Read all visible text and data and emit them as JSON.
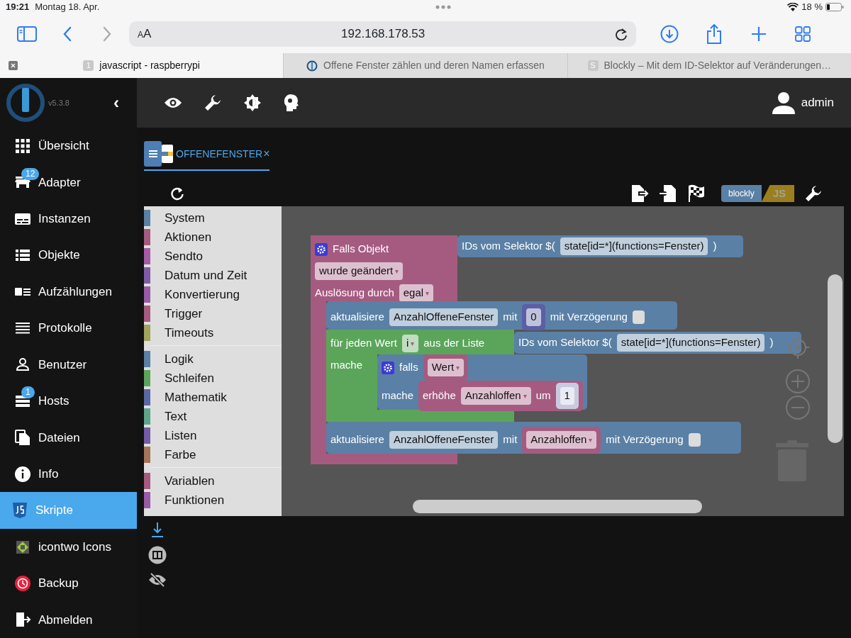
{
  "status_bar": {
    "time": "19:21",
    "date": "Montag 18. Apr.",
    "battery_text": "18 %"
  },
  "browser": {
    "text_size_button": "AA",
    "url": "192.168.178.53",
    "tabs": [
      {
        "title": "javascript - raspberrypi",
        "favicon": "1",
        "selected": true
      },
      {
        "title": "Offene Fenster zählen und deren Namen erfassen",
        "selected": false
      },
      {
        "title": "Blockly – Mit dem ID-Selektor auf Veränderungen…",
        "favicon": "S",
        "selected": false
      }
    ]
  },
  "sidebar": {
    "version": "v5.3.8",
    "collapse": "‹",
    "items": [
      {
        "label": "Übersicht",
        "selected": false
      },
      {
        "label": "Adapter",
        "badge": "12",
        "selected": false
      },
      {
        "label": "Instanzen",
        "selected": false
      },
      {
        "label": "Objekte",
        "selected": false
      },
      {
        "label": "Aufzählungen",
        "selected": false
      },
      {
        "label": "Protokolle",
        "selected": false
      },
      {
        "label": "Benutzer",
        "selected": false
      },
      {
        "label": "Hosts",
        "badge": "1",
        "selected": false
      },
      {
        "label": "Dateien",
        "selected": false
      },
      {
        "label": "Info",
        "selected": false
      },
      {
        "label": "Skripte",
        "selected": true
      },
      {
        "label": "icontwo Icons",
        "selected": false
      },
      {
        "label": "Backup",
        "selected": false
      },
      {
        "label": "Abmelden",
        "selected": false
      }
    ]
  },
  "header": {
    "user": "admin"
  },
  "script_tabs": [
    {
      "title": "OFFENEFENSTER",
      "close": "×",
      "selected": true
    }
  ],
  "toolbar": {
    "mode_toggle": [
      {
        "label": "blockly",
        "selected": true
      },
      {
        "label": "JS",
        "selected": false
      }
    ]
  },
  "toolbox": {
    "groups": [
      [
        {
          "label": "System",
          "color": "#5b80a5"
        },
        {
          "label": "Aktionen",
          "color": "#a55b80"
        },
        {
          "label": "Sendto",
          "color": "#a55ba5"
        },
        {
          "label": "Datum und Zeit",
          "color": "#805ba5"
        },
        {
          "label": "Konvertierung",
          "color": "#995ba5"
        },
        {
          "label": "Trigger",
          "color": "#a55b80"
        },
        {
          "label": "Timeouts",
          "color": "#9fa55b"
        }
      ],
      [
        {
          "label": "Logik",
          "color": "#5b80a5"
        },
        {
          "label": "Schleifen",
          "color": "#5ba55b"
        },
        {
          "label": "Mathematik",
          "color": "#5b67a5"
        },
        {
          "label": "Text",
          "color": "#5ba58c"
        },
        {
          "label": "Listen",
          "color": "#745ba5"
        },
        {
          "label": "Farbe",
          "color": "#a5745b"
        }
      ],
      [
        {
          "label": "Variablen",
          "color": "#a55b80"
        },
        {
          "label": "Funktionen",
          "color": "#995ba5"
        }
      ]
    ]
  },
  "workspace": {
    "blocks": [
      {
        "kind": "event",
        "lines": [
          {
            "parts": [
              {
                "kind": "gear"
              },
              {
                "kind": "text",
                "text": "Falls Objekt"
              }
            ]
          },
          {
            "parts": [
              {
                "kind": "dropdown",
                "text": "wurde geändert",
                "arrow": "▾"
              }
            ]
          },
          {
            "parts": [
              {
                "kind": "text",
                "text": "Auslösung durch"
              },
              {
                "kind": "dropdown",
                "text": "egal",
                "arrow": "▾"
              }
            ]
          }
        ],
        "attached": {
          "kind": "logic",
          "lines": [
            {
              "parts": [
                {
                  "kind": "text",
                  "text": "IDs vom Selektor $("
                },
                {
                  "kind": "field",
                  "text": "state[id=*](functions=Fenster)"
                },
                {
                  "kind": "text",
                  "text": ")"
                }
              ]
            }
          ]
        },
        "statements": [
          {
            "kind": "logic",
            "lines": [
              {
                "parts": [
                  {
                    "kind": "text",
                    "text": "aktualisiere"
                  },
                  {
                    "kind": "field",
                    "text": "AnzahlOffeneFenster"
                  },
                  {
                    "kind": "text",
                    "text": "mit"
                  },
                  {
                    "kind": "block",
                    "block": {
                      "kind": "math",
                      "lines": [
                        {
                          "parts": [
                            {
                              "kind": "field",
                              "text": "0"
                            }
                          ]
                        }
                      ]
                    }
                  },
                  {
                    "kind": "text",
                    "text": "mit Verzögerung"
                  },
                  {
                    "kind": "checkbox",
                    "checked": false
                  }
                ]
              }
            ]
          },
          {
            "kind": "loop",
            "lines": [
              {
                "parts": [
                  {
                    "kind": "text",
                    "text": "für jeden Wert"
                  },
                  {
                    "kind": "dropdown",
                    "text": "i",
                    "arrow": "▾"
                  },
                  {
                    "kind": "text",
                    "text": "aus der Liste"
                  }
                ]
              },
              {
                "parts": [
                  {
                    "kind": "text",
                    "text": "mache"
                  }
                ]
              }
            ],
            "attached": {
              "kind": "logic",
              "lines": [
                {
                  "parts": [
                    {
                      "kind": "text",
                      "text": "IDs vom Selektor $("
                    },
                    {
                      "kind": "field",
                      "text": "state[id=*](functions=Fenster)"
                    },
                    {
                      "kind": "text",
                      "text": ")"
                    }
                  ]
                }
              ]
            },
            "statements": [
              {
                "kind": "logic",
                "lines": [
                  {
                    "parts": [
                      {
                        "kind": "gear"
                      },
                      {
                        "kind": "text",
                        "text": "falls"
                      },
                      {
                        "kind": "block",
                        "block": {
                          "kind": "event",
                          "lines": [
                            {
                              "parts": [
                                {
                                  "kind": "dropdown",
                                  "text": "Wert",
                                  "arrow": "▾"
                                }
                              ]
                            }
                          ]
                        }
                      }
                    ]
                  },
                  {
                    "parts": [
                      {
                        "kind": "text",
                        "text": "mache"
                      },
                      {
                        "kind": "block",
                        "block": {
                          "kind": "event",
                          "lines": [
                            {
                              "parts": [
                                {
                                  "kind": "text",
                                  "text": "erhöhe"
                                },
                                {
                                  "kind": "dropdown",
                                  "text": "Anzahloffen",
                                  "arrow": "▾"
                                },
                                {
                                  "kind": "text",
                                  "text": "um"
                                },
                                {
                                  "kind": "block",
                                  "block": {
                                    "kind": "shadow",
                                    "lines": [
                                      {
                                        "parts": [
                                          {
                                            "kind": "field",
                                            "text": "1"
                                          }
                                        ]
                                      }
                                    ]
                                  }
                                }
                              ]
                            }
                          ]
                        }
                      }
                    ]
                  }
                ]
              }
            ]
          },
          {
            "kind": "logic",
            "lines": [
              {
                "parts": [
                  {
                    "kind": "text",
                    "text": "aktualisiere"
                  },
                  {
                    "kind": "field",
                    "text": "AnzahlOffeneFenster"
                  },
                  {
                    "kind": "text",
                    "text": "mit"
                  },
                  {
                    "kind": "block",
                    "block": {
                      "kind": "event",
                      "lines": [
                        {
                          "parts": [
                            {
                              "kind": "dropdown",
                              "text": "Anzahloffen",
                              "arrow": "▾"
                            }
                          ]
                        }
                      ]
                    }
                  },
                  {
                    "kind": "text",
                    "text": "mit Verzögerung"
                  },
                  {
                    "kind": "checkbox",
                    "checked": false
                  }
                ]
              }
            ]
          }
        ]
      }
    ]
  }
}
